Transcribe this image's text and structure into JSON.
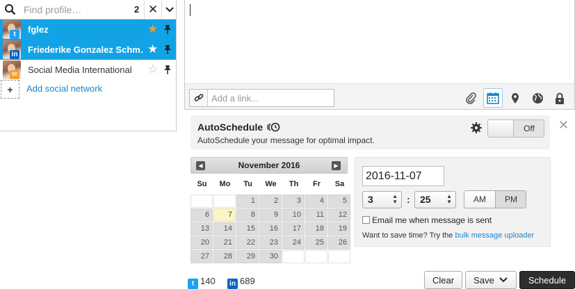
{
  "picker": {
    "search_placeholder": "Find profile…",
    "selected_count": "2",
    "clear_symbol": "✕",
    "profiles": [
      {
        "name": "fglez",
        "network": "twitter",
        "selected": true,
        "starred": true
      },
      {
        "name": "Friederike Gonzalez Schm…",
        "network": "linkedin",
        "selected": true,
        "starred": false
      },
      {
        "name": "Social Media International",
        "network": "other",
        "selected": false,
        "starred": false
      }
    ],
    "add_network_label": "Add social network"
  },
  "composer": {
    "link_placeholder": "Add a link..."
  },
  "autoschedule": {
    "title": "AutoSchedule",
    "subtitle": "AutoSchedule your message for optimal impact.",
    "toggle_state": "Off"
  },
  "calendar": {
    "month_label": "November 2016",
    "weekdays": [
      "Su",
      "Mo",
      "Tu",
      "We",
      "Th",
      "Fr",
      "Sa"
    ],
    "leading_blanks": 2,
    "days": [
      "1",
      "2",
      "3",
      "4",
      "5",
      "6",
      "7",
      "8",
      "9",
      "10",
      "11",
      "12",
      "13",
      "14",
      "15",
      "16",
      "17",
      "18",
      "19",
      "20",
      "21",
      "22",
      "23",
      "24",
      "25",
      "26",
      "27",
      "28",
      "29",
      "30"
    ],
    "today": "7"
  },
  "schedule": {
    "date_value": "2016-11-07",
    "hour": "3",
    "minute": "25",
    "colon": ":",
    "am_label": "AM",
    "pm_label": "PM",
    "active_period": "PM",
    "email_label": "Email me when message is sent",
    "bulk_prefix": "Want to save time? Try the ",
    "bulk_link": "bulk message uploader"
  },
  "footer": {
    "twitter_count": "140",
    "linkedin_count": "689",
    "clear_label": "Clear",
    "save_label": "Save",
    "schedule_label": "Schedule"
  },
  "colors": {
    "selected_row": "#12a3e6",
    "link": "#1987c9",
    "twitter": "#1da1f2",
    "linkedin": "#0a66c2",
    "star": "#f39c2b"
  }
}
